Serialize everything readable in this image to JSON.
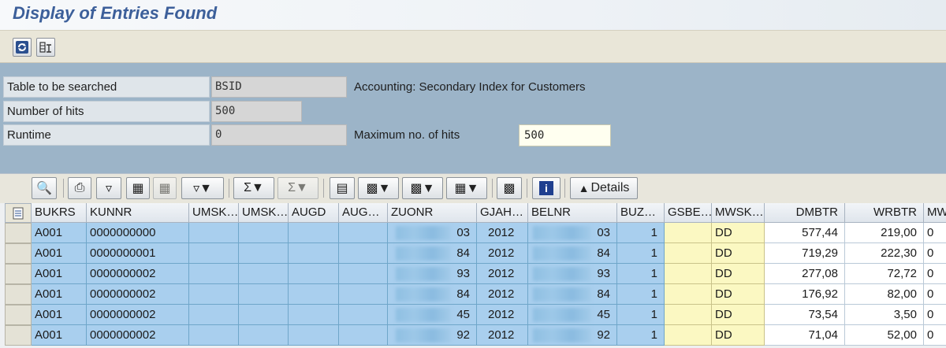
{
  "window": {
    "title": "Display of Entries Found"
  },
  "app_toolbar": {
    "icons": [
      "refresh-icon",
      "technical-settings-icon"
    ]
  },
  "header": {
    "table_label": "Table to be searched",
    "table_value": "BSID",
    "table_desc": "Accounting: Secondary Index for Customers",
    "hits_label": "Number of hits",
    "hits_value": "500",
    "runtime_label": "Runtime",
    "runtime_value": "0",
    "maxhits_label": "Maximum no. of hits",
    "maxhits_value": "500"
  },
  "grid_toolbar": {
    "details_label": "Details",
    "icons": [
      "zoom-icon",
      "print-icon",
      "filter-icon",
      "find-icon",
      "find-next-icon",
      "set-filter-icon",
      "sum-icon",
      "subtotal-icon",
      "print-preview-icon",
      "export-icon",
      "spreadsheet-icon",
      "change-layout-icon",
      "graphic-icon",
      "information-icon",
      "details-icon"
    ]
  },
  "columns": [
    "BUKRS",
    "KUNNR",
    "UMSK",
    "UMSK",
    "AUGD",
    "AUG",
    "ZUONR",
    "GJAH",
    "BELNR",
    "BUZ",
    "GSBE",
    "MWSK",
    "DMBTR",
    "WRBTR",
    "MW"
  ],
  "rows": [
    {
      "bukrs": "A001",
      "kunnr": "0000000000",
      "zuonr": "03",
      "gjahr": "2012",
      "belnr": "03",
      "buzei": "1",
      "mwskz": "DD",
      "dmbtr": "577,44",
      "wrbtr": "219,00",
      "mw": "0"
    },
    {
      "bukrs": "A001",
      "kunnr": "0000000001",
      "zuonr": "84",
      "gjahr": "2012",
      "belnr": "84",
      "buzei": "1",
      "mwskz": "DD",
      "dmbtr": "719,29",
      "wrbtr": "222,30",
      "mw": "0"
    },
    {
      "bukrs": "A001",
      "kunnr": "0000000002",
      "zuonr": "93",
      "gjahr": "2012",
      "belnr": "93",
      "buzei": "1",
      "mwskz": "DD",
      "dmbtr": "277,08",
      "wrbtr": "72,72",
      "mw": "0"
    },
    {
      "bukrs": "A001",
      "kunnr": "0000000002",
      "zuonr": "84",
      "gjahr": "2012",
      "belnr": "84",
      "buzei": "1",
      "mwskz": "DD",
      "dmbtr": "176,92",
      "wrbtr": "82,00",
      "mw": "0"
    },
    {
      "bukrs": "A001",
      "kunnr": "0000000002",
      "zuonr": "45",
      "gjahr": "2012",
      "belnr": "45",
      "buzei": "1",
      "mwskz": "DD",
      "dmbtr": "73,54",
      "wrbtr": "3,50",
      "mw": "0"
    },
    {
      "bukrs": "A001",
      "kunnr": "0000000002",
      "zuonr": "92",
      "gjahr": "2012",
      "belnr": "92",
      "buzei": "1",
      "mwskz": "DD",
      "dmbtr": "71,04",
      "wrbtr": "52,00",
      "mw": "0"
    }
  ],
  "colors": {
    "key_cell": "#a9cfee",
    "yellow_cell": "#fbf8c2",
    "header_bg": "#9cb4c8",
    "title": "#3c5f9a"
  }
}
